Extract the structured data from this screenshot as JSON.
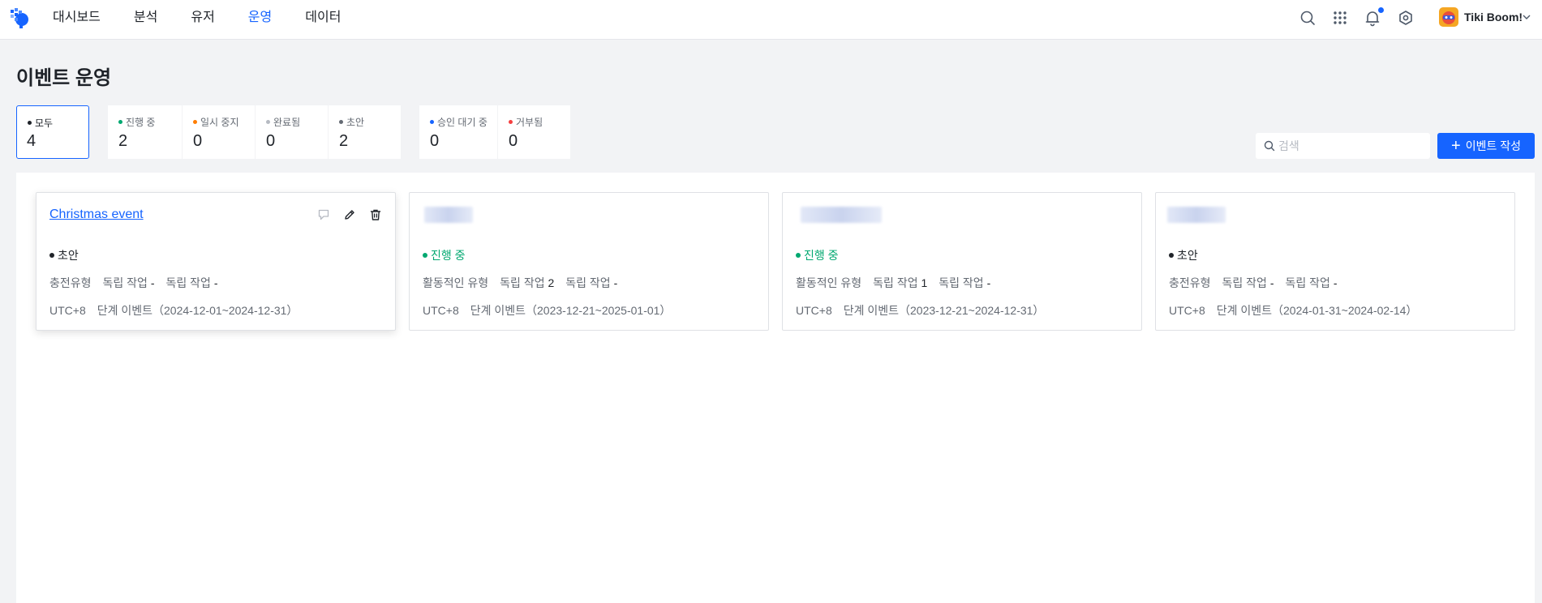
{
  "nav": {
    "items": [
      "대시보드",
      "분석",
      "유저",
      "운영",
      "데이터"
    ],
    "active_index": 3
  },
  "header": {
    "user_name": "Tiki Boom!",
    "icons": [
      "search-icon",
      "apps-grid-icon",
      "bell-icon",
      "settings-icon"
    ],
    "has_notification": true
  },
  "page": {
    "title": "이벤트 운영"
  },
  "stats": [
    {
      "label": "모두",
      "count": "4",
      "dot_color": "#1f2329",
      "selected": true
    },
    {
      "label": "진행 중",
      "count": "2",
      "dot_color": "#00a870",
      "selected": false
    },
    {
      "label": "일시 중지",
      "count": "0",
      "dot_color": "#ff7d00",
      "selected": false
    },
    {
      "label": "완료됨",
      "count": "0",
      "dot_color": "#b6bac2",
      "selected": false
    },
    {
      "label": "초안",
      "count": "2",
      "dot_color": "#646a73",
      "selected": false
    },
    {
      "label": "승인 대기 중",
      "count": "0",
      "dot_color": "#1664ff",
      "selected": false
    },
    {
      "label": "거부됨",
      "count": "0",
      "dot_color": "#f53f3f",
      "selected": false
    }
  ],
  "search": {
    "placeholder": "검색"
  },
  "create_button": {
    "label": "이벤트 작성"
  },
  "cards": [
    {
      "name": "Christmas event",
      "name_obscured": false,
      "status": "초안",
      "status_color": "#1f2329",
      "type": "충전유형",
      "task1_label": "독립 작업",
      "task1_value": "-",
      "task2_label": "독립 작업",
      "task2_value": "-",
      "timezone": "UTC+8",
      "event_range": "단계 이벤트（2024-12-01~2024-12-31）",
      "show_actions": true
    },
    {
      "name": "",
      "name_obscured": true,
      "status": "진행 중",
      "status_color": "#00a870",
      "type": "활동적인 유형",
      "task1_label": "독립 작업",
      "task1_value": "2",
      "task2_label": "독립 작업",
      "task2_value": "-",
      "timezone": "UTC+8",
      "event_range": "단계 이벤트（2023-12-21~2025-01-01）",
      "show_actions": false
    },
    {
      "name": "",
      "name_obscured": true,
      "status": "진행 중",
      "status_color": "#00a870",
      "type": "활동적인 유형",
      "task1_label": "독립 작업",
      "task1_value": "1",
      "task2_label": "독립 작업",
      "task2_value": "-",
      "timezone": "UTC+8",
      "event_range": "단계 이벤트（2023-12-21~2024-12-31）",
      "show_actions": false
    },
    {
      "name": "",
      "name_obscured": true,
      "status": "초안",
      "status_color": "#1f2329",
      "type": "충전유형",
      "task1_label": "독립 작업",
      "task1_value": "-",
      "task2_label": "독립 작업",
      "task2_value": "-",
      "timezone": "UTC+8",
      "event_range": "단계 이벤트（2024-01-31~2024-02-14）",
      "show_actions": false
    }
  ]
}
